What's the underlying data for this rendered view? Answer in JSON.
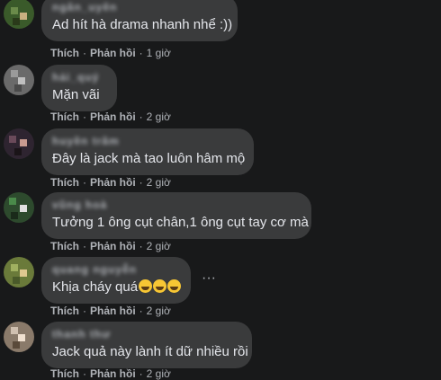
{
  "comments": [
    {
      "author": "ngân_uyên",
      "text": "Ad hít hà drama nhanh nhể :))",
      "like": "Thích",
      "reply": "Phản hồi",
      "time": "1 giờ",
      "avatar_color": "#3a5a2a"
    },
    {
      "author": "hải_quý",
      "text": "Mặn vãi",
      "like": "Thích",
      "reply": "Phản hồi",
      "time": "2 giờ",
      "avatar_color": "#7a7a7a"
    },
    {
      "author": "huyền trâm",
      "text": "Đây là jack mà tao luôn hâm mộ",
      "like": "Thích",
      "reply": "Phản hồi",
      "time": "2 giờ",
      "avatar_color": "#3a2a3a"
    },
    {
      "author": "vũng hoà",
      "text": "Tưởng 1 ông cụt chân,1 ông cụt tay cơ mà",
      "like": "Thích",
      "reply": "Phản hồi",
      "time": "2 giờ",
      "avatar_color": "#2d4a2d"
    },
    {
      "author": "quang nguyễn",
      "text": "Khịa cháy quá",
      "like": "Thích",
      "reply": "Phản hồi",
      "time": "2 giờ",
      "avatar_color": "#7a8a4a",
      "emoji_icons": [
        "rofl-emoji-icon",
        "rofl-emoji-icon",
        "rofl-emoji-icon"
      ]
    },
    {
      "author": "thanh thư",
      "text": "Jack quả này lành ít dữ nhiều rồi",
      "like": "Thích",
      "reply": "Phản hồi",
      "time": "2 giờ",
      "avatar_color": "#8a7a6a"
    }
  ],
  "more_options_icon": "more-horizontal-icon",
  "more_options_label": "···"
}
